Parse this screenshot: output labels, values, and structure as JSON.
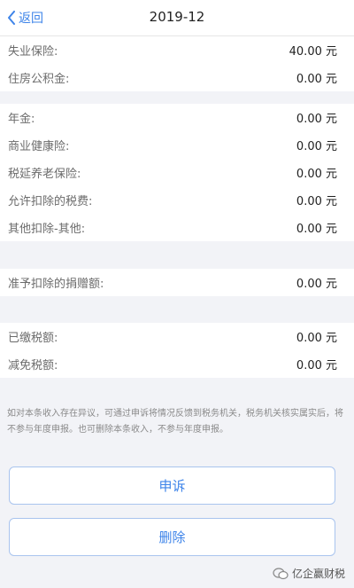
{
  "nav": {
    "back_label": "返回",
    "title": "2019-12"
  },
  "section1": [
    {
      "label": "失业保险:",
      "value": "40.00 元"
    },
    {
      "label": "住房公积金:",
      "value": "0.00 元"
    }
  ],
  "section2": [
    {
      "label": "年金:",
      "value": "0.00 元"
    },
    {
      "label": "商业健康险:",
      "value": "0.00 元"
    },
    {
      "label": "税延养老保险:",
      "value": "0.00 元"
    },
    {
      "label": "允许扣除的税费:",
      "value": "0.00 元"
    },
    {
      "label": "其他扣除-其他:",
      "value": "0.00 元"
    }
  ],
  "section3": [
    {
      "label": "准予扣除的捐赠额:",
      "value": "0.00 元"
    }
  ],
  "section4": [
    {
      "label": "已缴税额:",
      "value": "0.00 元"
    },
    {
      "label": "减免税额:",
      "value": "0.00 元"
    }
  ],
  "note": "如对本条收入存在异议，可通过申诉将情况反馈到税务机关，税务机关核实属实后，将不参与年度申报。也可删除本条收入，不参与年度申报。",
  "buttons": {
    "appeal": "申诉",
    "delete": "删除"
  },
  "watermark": "亿企赢财税",
  "colors": {
    "accent": "#3e84e9",
    "background": "#f2f3f7"
  },
  "icons": {
    "back": "chevron-left-icon",
    "watermark": "wechat-icon"
  }
}
